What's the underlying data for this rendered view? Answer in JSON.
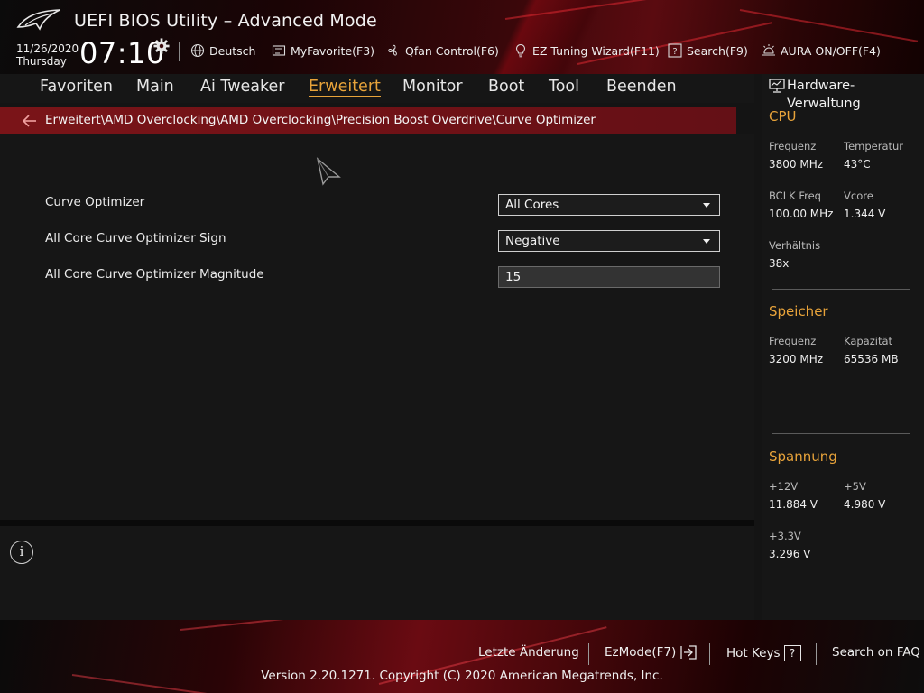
{
  "header": {
    "title": "UEFI BIOS Utility – Advanced Mode",
    "date": "11/26/2020",
    "weekday": "Thursday",
    "time": "07:10",
    "toolbar": [
      {
        "label": "Deutsch",
        "icon": "globe-icon"
      },
      {
        "label": "MyFavorite(F3)",
        "icon": "favorite-list-icon"
      },
      {
        "label": "Qfan Control(F6)",
        "icon": "fan-icon"
      },
      {
        "label": "EZ Tuning Wizard(F11)",
        "icon": "lightbulb-icon"
      },
      {
        "label": "Search(F9)",
        "icon": "question-box-icon"
      },
      {
        "label": "AURA ON/OFF(F4)",
        "icon": "aura-light-icon"
      }
    ]
  },
  "nav": {
    "active": "Erweitert",
    "items": [
      "Favoriten",
      "Main",
      "Ai Tweaker",
      "Erweitert",
      "Monitor",
      "Boot",
      "Tool",
      "Beenden"
    ]
  },
  "breadcrumb": {
    "path": "Erweitert\\AMD Overclocking\\AMD Overclocking\\Precision Boost Overdrive\\Curve Optimizer"
  },
  "settings": [
    {
      "label": "Curve Optimizer",
      "type": "select",
      "value": "All Cores"
    },
    {
      "label": "All Core Curve Optimizer Sign",
      "type": "select",
      "value": "Negative"
    },
    {
      "label": "All Core Curve Optimizer Magnitude",
      "type": "input",
      "value": "15"
    }
  ],
  "hardware": {
    "title": "Hardware-Verwaltung",
    "cpu": {
      "heading": "CPU",
      "freq_label": "Frequenz",
      "freq_value": "3800 MHz",
      "temp_label": "Temperatur",
      "temp_value": "43°C",
      "bclk_label": "BCLK Freq",
      "bclk_value": "100.00 MHz",
      "vcore_label": "Vcore",
      "vcore_value": "1.344 V",
      "ratio_label": "Verhältnis",
      "ratio_value": "38x"
    },
    "memory": {
      "heading": "Speicher",
      "freq_label": "Frequenz",
      "freq_value": "3200 MHz",
      "cap_label": "Kapazität",
      "cap_value": "65536 MB"
    },
    "voltage": {
      "heading": "Spannung",
      "v12_label": "+12V",
      "v12_value": "11.884 V",
      "v5_label": "+5V",
      "v5_value": "4.980 V",
      "v33_label": "+3.3V",
      "v33_value": "3.296 V"
    }
  },
  "footer": {
    "last_change": "Letzte Änderung",
    "ezmode": "EzMode(F7)",
    "hotkeys": "Hot Keys",
    "hotkeys_key": "?",
    "faq": "Search on FAQ",
    "copyright": "Version 2.20.1271. Copyright (C) 2020 American Megatrends, Inc."
  },
  "colors": {
    "accent": "#e8a33a",
    "breadcrumb_bg": "#7a1418",
    "panel_bg": "#161616"
  }
}
